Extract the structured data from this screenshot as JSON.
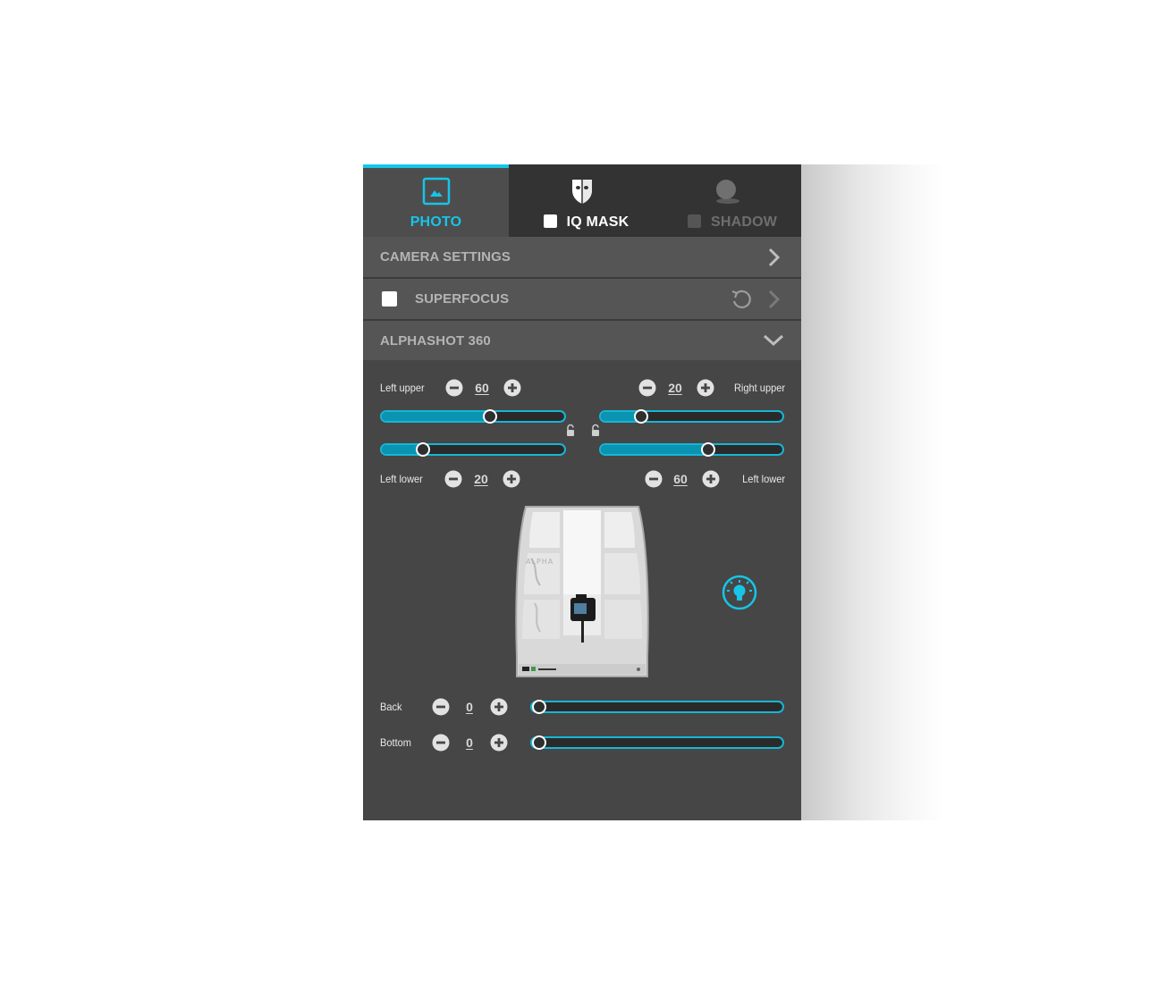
{
  "tabs": {
    "photo": {
      "label": "PHOTO",
      "icon": "image-icon",
      "active": true
    },
    "iq_mask": {
      "label": "IQ MASK",
      "icon": "mask-icon",
      "checked": false
    },
    "shadow": {
      "label": "SHADOW",
      "icon": "shadow-icon",
      "disabled": true
    }
  },
  "sections": {
    "camera_settings": {
      "title": "CAMERA SETTINGS",
      "icon": "chevron-right-icon"
    },
    "superfocus": {
      "title": "SUPERFOCUS",
      "checked": false,
      "icons": [
        "reset-icon",
        "chevron-right-icon"
      ]
    },
    "alphashot": {
      "title": "ALPHASHOT 360",
      "icon": "chevron-down-icon",
      "expanded": true
    }
  },
  "lights": {
    "left_upper": {
      "label": "Left upper",
      "value": "60",
      "level_percent": 60
    },
    "right_upper": {
      "label": "Right upper",
      "value": "20",
      "level_percent": 20
    },
    "left_lower": {
      "label": "Left lower",
      "value": "20",
      "level_percent": 20
    },
    "right_lower": {
      "label": "Left lower",
      "value": "60",
      "level_percent": 60
    },
    "back": {
      "label": "Back",
      "value": "0",
      "level_percent": 0
    },
    "bottom": {
      "label": "Bottom",
      "value": "0",
      "level_percent": 0
    }
  },
  "colors": {
    "accent": "#16c5e8",
    "panel_bg": "#464646",
    "section_bg": "#555555",
    "tab_bar_bg": "#333333"
  }
}
